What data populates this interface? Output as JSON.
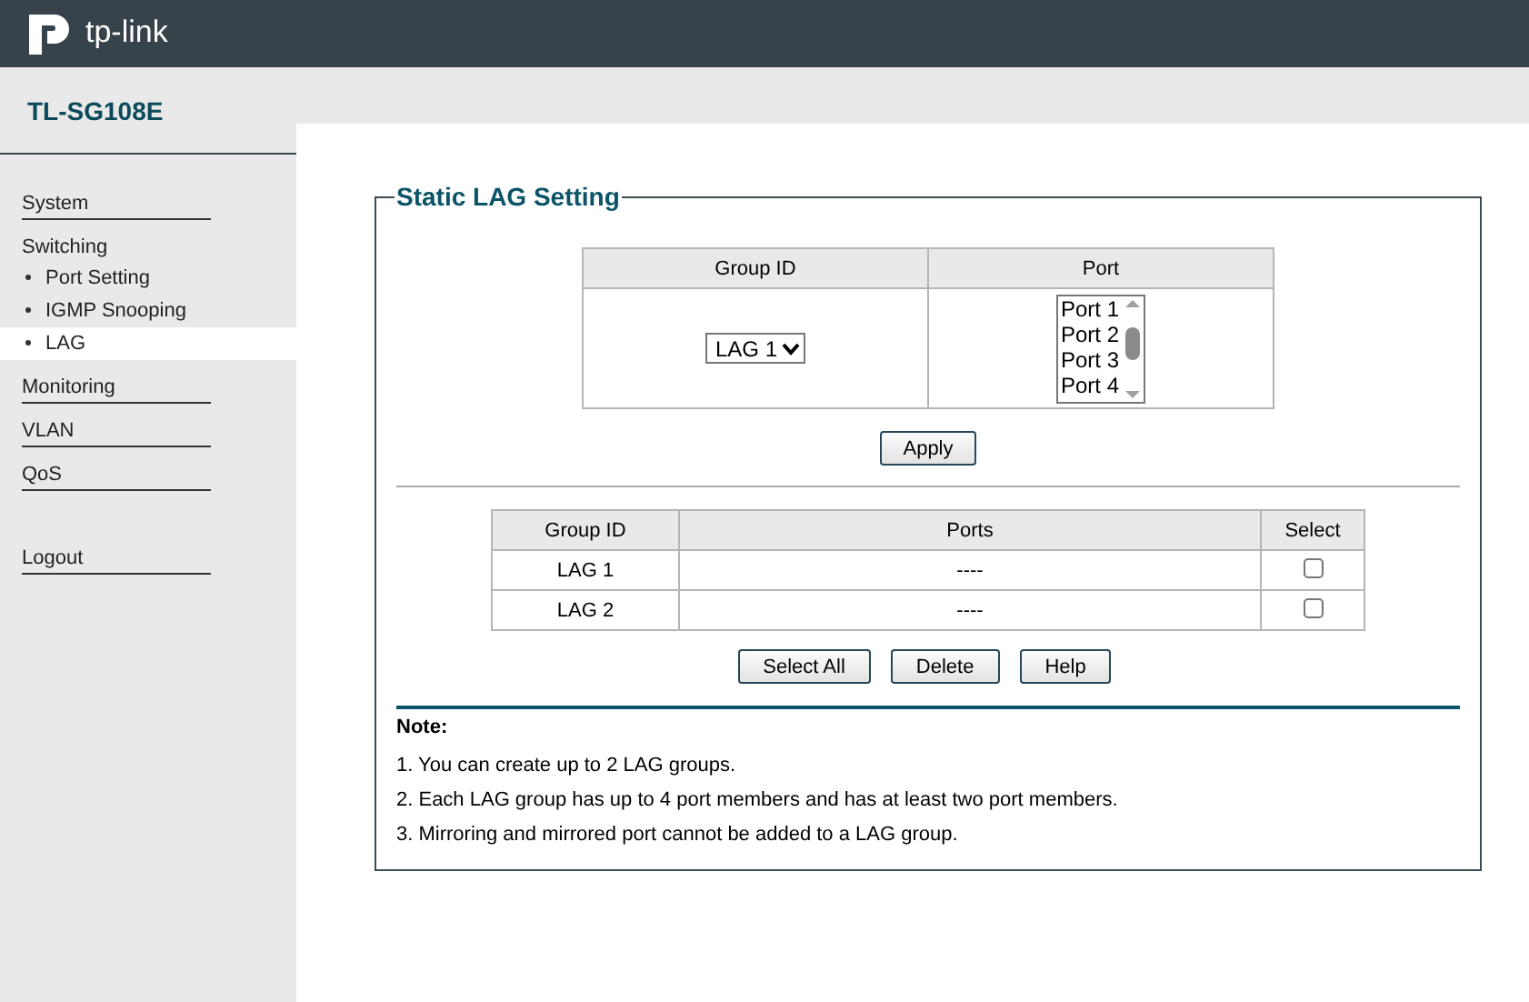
{
  "header": {
    "logo_text": "tp-link"
  },
  "device": {
    "model": "TL-SG108E"
  },
  "sidebar": {
    "items": [
      {
        "label": "System",
        "kind": "link",
        "selected": false
      },
      {
        "label": "Switching",
        "kind": "heading",
        "selected": false
      },
      {
        "label": "Port Setting",
        "kind": "sub",
        "selected": false
      },
      {
        "label": "IGMP Snooping",
        "kind": "sub",
        "selected": false
      },
      {
        "label": "LAG",
        "kind": "sub",
        "selected": true
      },
      {
        "label": "Monitoring",
        "kind": "link",
        "selected": false
      },
      {
        "label": "VLAN",
        "kind": "link",
        "selected": false
      },
      {
        "label": "QoS",
        "kind": "link",
        "selected": false
      }
    ],
    "logout": "Logout"
  },
  "panel": {
    "title": "Static LAG Setting",
    "setting_table": {
      "columns": [
        "Group ID",
        "Port"
      ],
      "group_select": "LAG 1",
      "ports": [
        "Port 1",
        "Port 2",
        "Port 3",
        "Port 4"
      ]
    },
    "apply_button": "Apply",
    "lag_table": {
      "columns": [
        "Group ID",
        "Ports",
        "Select"
      ],
      "rows": [
        {
          "group": "LAG 1",
          "ports": "----",
          "checked": false
        },
        {
          "group": "LAG 2",
          "ports": "----",
          "checked": false
        }
      ]
    },
    "buttons": [
      "Select All",
      "Delete",
      "Help"
    ],
    "note": {
      "title": "Note:",
      "lines": [
        "1. You can create up to 2 LAG groups.",
        "2. Each LAG group has up to 4 port members and has at least two port members.",
        "3. Mirroring and mirrored port cannot be added to a LAG group."
      ]
    }
  }
}
